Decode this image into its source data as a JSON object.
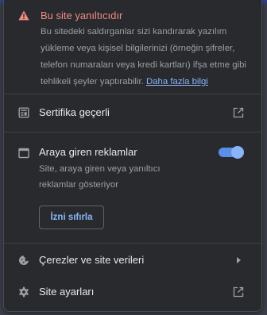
{
  "warning": {
    "title": "Bu site yanıltıcıdır",
    "body": "Bu sitedeki saldırganlar sizi kandırarak yazılım yükleme veya kişisel bilgilerinizi (örneğin şifreler, telefon numaraları veya kredi kartları) ifşa etme gibi tehlikeli şeyler yaptırabilir.",
    "link": "Daha fazla bilgi",
    "color": "#f28b82"
  },
  "certificate": {
    "label": "Sertifika geçerli",
    "icon": "certificate-icon",
    "trailing_icon": "external-link-icon"
  },
  "ads": {
    "title": "Araya giren reklamlar",
    "description": "Site, araya giren veya yanıltıcı reklamlar gösteriyor",
    "toggle_on": true,
    "reset_label": "İzni sıfırla",
    "icon": "browser-window-icon"
  },
  "cookies": {
    "label": "Çerezler ve site verileri",
    "icon": "cookie-icon",
    "trailing_icon": "chevron-right-icon"
  },
  "site_settings": {
    "label": "Site ayarları",
    "icon": "gear-icon",
    "trailing_icon": "external-link-icon"
  },
  "colors": {
    "accent": "#8ab4f8",
    "panel_bg": "#292a2d",
    "text": "#e8eaed",
    "secondary_text": "#9aa0a6"
  }
}
